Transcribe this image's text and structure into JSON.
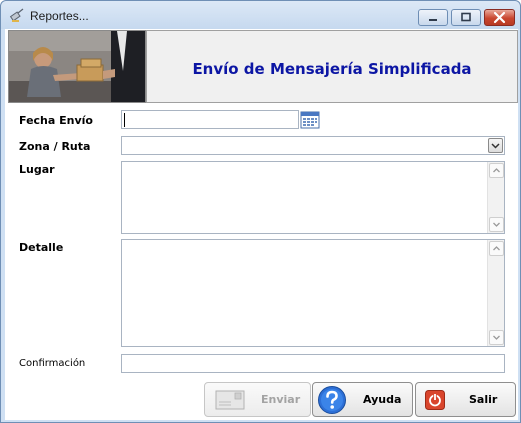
{
  "window": {
    "title": "Reportes..."
  },
  "header": {
    "title": "Envío de Mensajería Simplificada"
  },
  "form": {
    "fecha_label": "Fecha Envío",
    "fecha_value": "",
    "zona_label": "Zona / Ruta",
    "zona_value": "",
    "lugar_label": "Lugar",
    "lugar_value": "",
    "detalle_label": "Detalle",
    "detalle_value": "",
    "confirmacion_label": "Confirmación",
    "confirmacion_value": ""
  },
  "buttons": {
    "enviar": "Enviar",
    "ayuda": "Ayuda",
    "salir": "Salir"
  },
  "colors": {
    "title_blue": "#0c16a4",
    "window_frame": "#cfe0f3",
    "close_red": "#c9462f"
  },
  "icons": {
    "app": "satellite-icon",
    "calendar": "calendar-icon",
    "enviar": "envelope-icon",
    "ayuda": "help-icon",
    "salir": "exit-icon"
  }
}
